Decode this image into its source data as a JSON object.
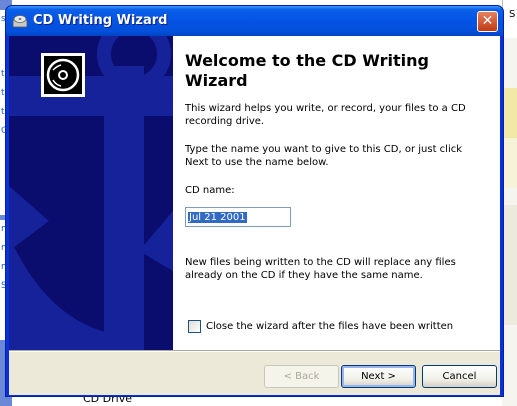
{
  "background": {
    "left_strip_letters": [
      "s",
      "th",
      "th",
      "th",
      "O",
      "m",
      "m",
      "m",
      "S"
    ],
    "right_top_text": "S",
    "bottom_item_label": "CD Drive"
  },
  "window": {
    "title": "CD Writing Wizard",
    "close_label": "✕"
  },
  "content": {
    "heading": "Welcome to the CD Writing Wizard",
    "intro": "This wizard helps you write, or record, your files to a CD recording drive.",
    "instruction": "Type the name you want to give to this CD, or just click Next to use the name below.",
    "cd_name_label": "CD name:",
    "cd_name_value": "Jul 21 2001",
    "replace_notice": "New files being written to the CD will replace any files already on the CD if they have the same name.",
    "close_after_label": "Close the wizard after the files have been written",
    "close_after_checked": false
  },
  "buttons": {
    "back": "< Back",
    "next": "Next >",
    "cancel": "Cancel"
  },
  "colors": {
    "titlebar": "#0553e4",
    "side_panel": "#0a0d6e",
    "selection": "#316ac5"
  }
}
